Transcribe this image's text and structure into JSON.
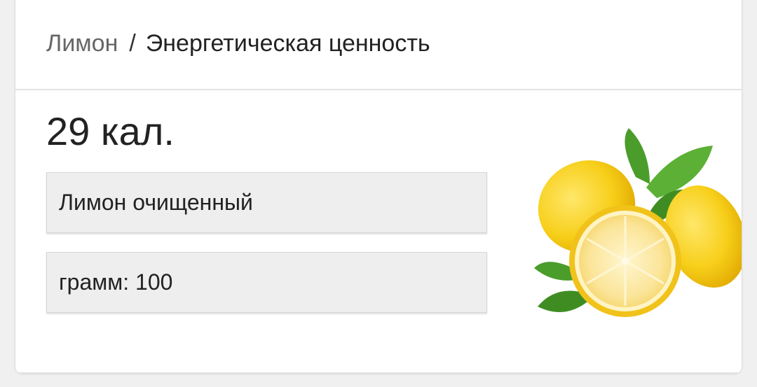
{
  "breadcrumb": {
    "parent": "Лимон",
    "separator": "/",
    "current": "Энергетическая ценность"
  },
  "calories": "29 кал.",
  "product_field": {
    "value": "Лимон очищенный"
  },
  "grams_field": {
    "value": "грамм: 100"
  },
  "image": {
    "subject": "lemons-with-leaves"
  },
  "colors": {
    "lemon": "#f7cf1a",
    "lemon_flesh": "#fbe59a",
    "leaf": "#4a9d2a",
    "field_bg": "#eeeeee"
  }
}
